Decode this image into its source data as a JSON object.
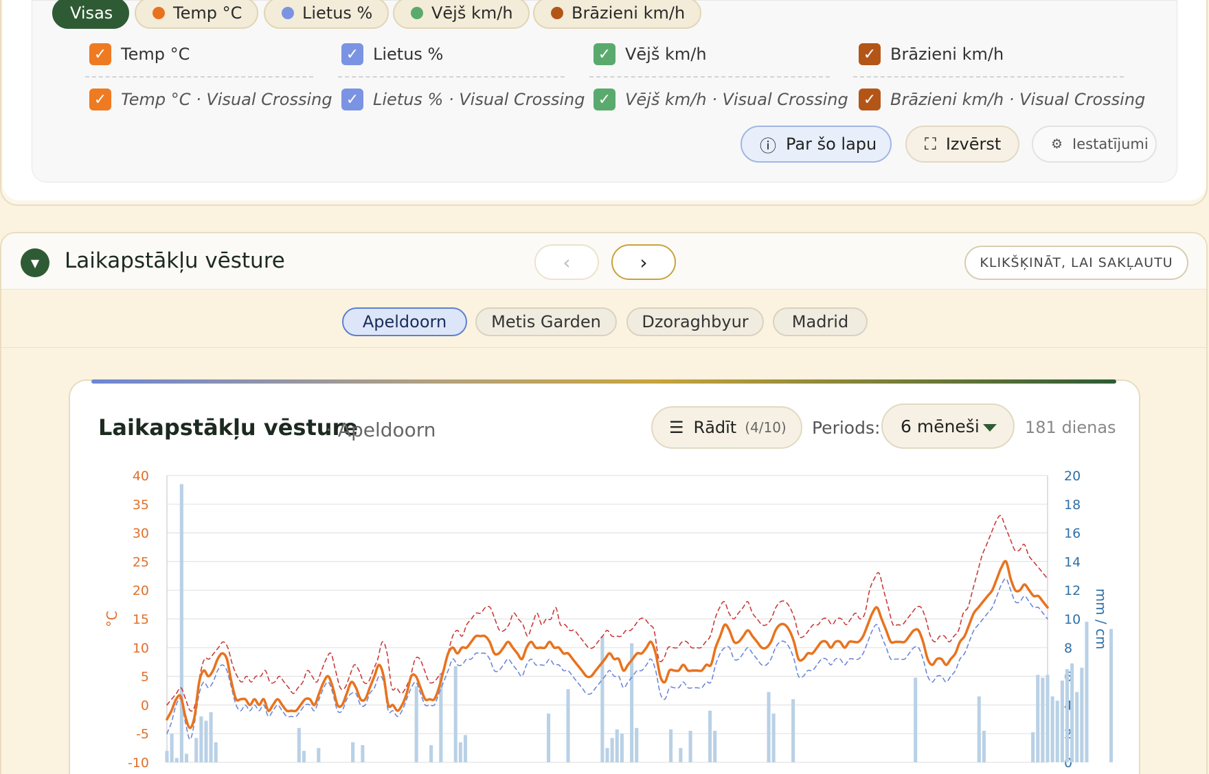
{
  "filters": {
    "all_label": "Visas",
    "items": [
      {
        "label": "Temp °C",
        "color": "#e8731f"
      },
      {
        "label": "Lietus %",
        "color": "#7b93e3"
      },
      {
        "label": "Vējš km/h",
        "color": "#5aaa6e"
      },
      {
        "label": "Brāzieni km/h",
        "color": "#b45518"
      }
    ]
  },
  "checkboxes": {
    "primary": [
      "Temp °C",
      "Lietus %",
      "Vējš km/h",
      "Brāzieni km/h"
    ],
    "secondary": [
      "Temp °C · Visual Crossing",
      "Lietus % · Visual Crossing",
      "Vējš km/h · Visual Crossing",
      "Brāzieni km/h · Visual Crossing"
    ],
    "colors": [
      "#ee7a22",
      "#7b93e3",
      "#5aaa6e",
      "#b45518"
    ]
  },
  "actions": {
    "about": "Par šo lapu",
    "expand": "Izvērst",
    "settings": "Iestatījumi"
  },
  "history": {
    "title": "Laikapstākļu vēsture",
    "prev": "‹",
    "next": "›",
    "collapse": "KLIKŠĶINĀT, LAI SAKĻAUTU",
    "locations": [
      "Apeldoorn",
      "Metis Garden",
      "Dzoraghbyur",
      "Madrid"
    ]
  },
  "chart_card": {
    "title": "Laikapstākļu vēsture",
    "subtitle": "· Apeldoorn",
    "show_label": "Rādīt",
    "show_count": "(4/10)",
    "period_label": "Periods:",
    "period_value": "6 mēneši",
    "days": "181 dienas"
  },
  "chart_data": {
    "type": "line",
    "left_axis": {
      "label": "°C",
      "range": [
        -10,
        40
      ],
      "ticks": [
        40,
        35,
        30,
        25,
        20,
        15,
        10,
        5,
        0,
        -5,
        -10
      ]
    },
    "right_axis": {
      "label": "mm / cm",
      "range": [
        0,
        20
      ],
      "ticks": [
        20,
        18,
        16,
        14,
        12,
        10,
        8,
        6,
        4,
        2,
        0
      ]
    },
    "x_days": 181,
    "grid": true,
    "series": [
      {
        "style": "solid",
        "color": "#e8731f",
        "axis": "left",
        "values": [
          -2.5,
          -1,
          1,
          1.5,
          -2,
          -4,
          -2,
          4,
          6,
          5,
          6,
          8,
          9,
          8,
          4,
          1,
          1,
          1,
          0,
          1,
          0,
          1,
          -1,
          0,
          1,
          0,
          -1,
          -1,
          -1,
          0,
          1,
          1,
          0,
          2,
          4,
          5,
          3,
          0,
          0,
          2,
          4,
          3,
          1,
          1,
          3,
          5,
          7,
          5,
          0,
          0,
          -1,
          0,
          2,
          5,
          5,
          3,
          1,
          1,
          1,
          3,
          6,
          9,
          10,
          9,
          10,
          10,
          11,
          12,
          12,
          12,
          11,
          9,
          9,
          10,
          11,
          10,
          9,
          8,
          10,
          11,
          10,
          10,
          10,
          11,
          10,
          10,
          9,
          9,
          8,
          7,
          6,
          5,
          5,
          6,
          7,
          8,
          9,
          8,
          8,
          6,
          7,
          8,
          9,
          9,
          10,
          11,
          9,
          5,
          4,
          6,
          6,
          6,
          7,
          6,
          6,
          6,
          6,
          7,
          7,
          10,
          12,
          14,
          13,
          11,
          11,
          12,
          13,
          12,
          11,
          10,
          10,
          11,
          13,
          14,
          14,
          13,
          11,
          8,
          8,
          9,
          9,
          10,
          11,
          11,
          10,
          11,
          11,
          10,
          11,
          11,
          11,
          12,
          14,
          16,
          17,
          15,
          13,
          11,
          11,
          11,
          11,
          12,
          13,
          13,
          11,
          8,
          7,
          8,
          8,
          7,
          8,
          9,
          11,
          12,
          14,
          16,
          17,
          18,
          19,
          20,
          22,
          24,
          25,
          22,
          20,
          20,
          21,
          20,
          19,
          19,
          18,
          17
        ]
      },
      {
        "style": "dashed",
        "color": "#c93a3a",
        "axis": "left",
        "values": [
          0,
          1,
          2,
          3,
          1,
          -1,
          0,
          5,
          8,
          8,
          9,
          10,
          11,
          10,
          7,
          5,
          4,
          5,
          4,
          5,
          5,
          6,
          4,
          4,
          5,
          4,
          3,
          2,
          3,
          4,
          6,
          5,
          4,
          6,
          8,
          9,
          6,
          3,
          3,
          5,
          7,
          6,
          4,
          4,
          6,
          8,
          11,
          9,
          3,
          3,
          2,
          3,
          5,
          8,
          8,
          6,
          4,
          4,
          5,
          6,
          9,
          12,
          13,
          12,
          14,
          15,
          16,
          16,
          17,
          17,
          15,
          13,
          13,
          14,
          16,
          15,
          14,
          12,
          14,
          16,
          14,
          15,
          15,
          17,
          14,
          14,
          13,
          13,
          12,
          11,
          10,
          10,
          11,
          12,
          13,
          12,
          12,
          12,
          13,
          13,
          14,
          15,
          15,
          14,
          13,
          8,
          8,
          10,
          10,
          10,
          11,
          11,
          10,
          10,
          10,
          11,
          12,
          15,
          17,
          18,
          16,
          15,
          16,
          17,
          18,
          16,
          15,
          14,
          14,
          15,
          17,
          18,
          18,
          17,
          15,
          12,
          12,
          13,
          14,
          14,
          15,
          15,
          14,
          15,
          15,
          14,
          15,
          16,
          15,
          16,
          20,
          22,
          23,
          20,
          17,
          14,
          14,
          14,
          15,
          16,
          17,
          17,
          15,
          12,
          11,
          12,
          12,
          11,
          12,
          13,
          16,
          17,
          20,
          23,
          26,
          28,
          30,
          32,
          33,
          31,
          29,
          27,
          27,
          28,
          26,
          25,
          24,
          23,
          22
        ]
      },
      {
        "style": "dashed",
        "color": "#6d86d6",
        "axis": "left",
        "values": [
          -5,
          -3,
          0,
          1,
          -3,
          -6,
          -3,
          2,
          4,
          3,
          4,
          6,
          7,
          6,
          3,
          0,
          -1,
          0,
          -1,
          0,
          -1,
          0,
          -2,
          -1,
          0,
          -1,
          -2,
          -2,
          -2,
          -1,
          0,
          0,
          -1,
          1,
          3,
          4,
          2,
          -1,
          -1,
          1,
          2,
          2,
          0,
          0,
          2,
          3,
          5,
          4,
          -1,
          -1,
          -2,
          -1,
          1,
          3,
          4,
          2,
          0,
          0,
          0,
          2,
          4,
          6,
          8,
          7,
          7,
          8,
          8,
          9,
          9,
          9,
          8,
          6,
          6,
          7,
          8,
          7,
          6,
          5,
          7,
          8,
          7,
          7,
          7,
          8,
          7,
          7,
          6,
          6,
          5,
          4,
          3,
          2,
          2,
          3,
          4,
          5,
          6,
          5,
          5,
          3,
          4,
          5,
          6,
          6,
          7,
          8,
          6,
          2,
          1,
          3,
          3,
          3,
          4,
          3,
          3,
          3,
          3,
          4,
          4,
          7,
          9,
          10,
          10,
          8,
          8,
          9,
          10,
          9,
          8,
          7,
          7,
          8,
          10,
          11,
          11,
          10,
          8,
          5,
          5,
          6,
          6,
          7,
          8,
          8,
          7,
          8,
          8,
          7,
          8,
          8,
          8,
          9,
          11,
          13,
          14,
          12,
          10,
          8,
          8,
          8,
          8,
          9,
          10,
          10,
          8,
          5,
          4,
          5,
          5,
          4,
          5,
          6,
          8,
          9,
          11,
          13,
          14,
          15,
          16,
          17,
          19,
          21,
          22,
          20,
          18,
          18,
          19,
          18,
          17,
          17,
          16,
          15
        ]
      }
    ],
    "bars": {
      "color": "#b9d1e6",
      "axis": "right",
      "values": [
        0.8,
        2,
        0.3,
        19.4,
        0.6,
        0,
        1.7,
        3.2,
        2.9,
        3.5,
        1.4,
        0,
        0,
        0,
        0,
        0,
        0,
        0,
        0,
        0,
        0,
        0,
        0,
        0,
        0,
        0,
        0,
        2.4,
        0.8,
        0,
        0,
        1,
        0,
        0,
        0,
        0,
        0,
        0,
        1.4,
        0,
        1.2,
        0,
        0,
        0,
        0,
        0,
        0,
        0,
        0,
        0,
        0,
        5.3,
        0,
        0,
        1.2,
        0,
        6.2,
        0,
        0,
        6.7,
        1.4,
        1.9,
        0,
        0,
        0,
        0,
        0,
        0,
        0,
        0,
        0,
        0,
        0,
        0,
        0,
        0,
        0,
        0,
        3.4,
        0,
        0,
        0,
        5.1,
        0,
        0,
        0,
        0,
        0,
        0,
        8.8,
        1,
        1.7,
        2.3,
        2,
        0,
        8.3,
        2.4,
        0,
        0,
        0,
        0,
        0,
        0,
        2.3,
        0,
        1,
        0,
        2.2,
        0,
        0,
        0,
        3.6,
        2.2,
        0,
        0,
        0,
        0,
        0,
        0,
        0,
        0,
        0,
        0,
        4.9,
        3.4,
        0,
        0,
        0,
        4.4,
        0,
        0,
        0,
        0,
        0,
        0,
        0,
        0,
        0,
        0,
        0,
        0,
        0,
        0,
        0,
        0,
        0,
        0,
        0,
        0,
        0,
        0,
        0,
        0,
        5.9,
        0,
        0,
        0,
        0,
        0,
        0,
        0,
        0,
        0,
        0,
        0,
        0,
        4.6,
        2.2,
        0,
        0,
        0,
        0,
        0,
        0,
        0,
        0,
        0,
        2.1,
        6.1,
        5.9,
        6.1,
        4.6,
        4.3,
        5.7,
        6.5,
        6.9,
        4.9,
        6.6,
        9.8,
        0,
        0,
        0,
        0,
        9.3,
        0,
        8.7,
        0,
        8.1,
        0,
        2.8,
        2.1,
        0,
        0,
        0,
        0,
        0
      ]
    }
  }
}
